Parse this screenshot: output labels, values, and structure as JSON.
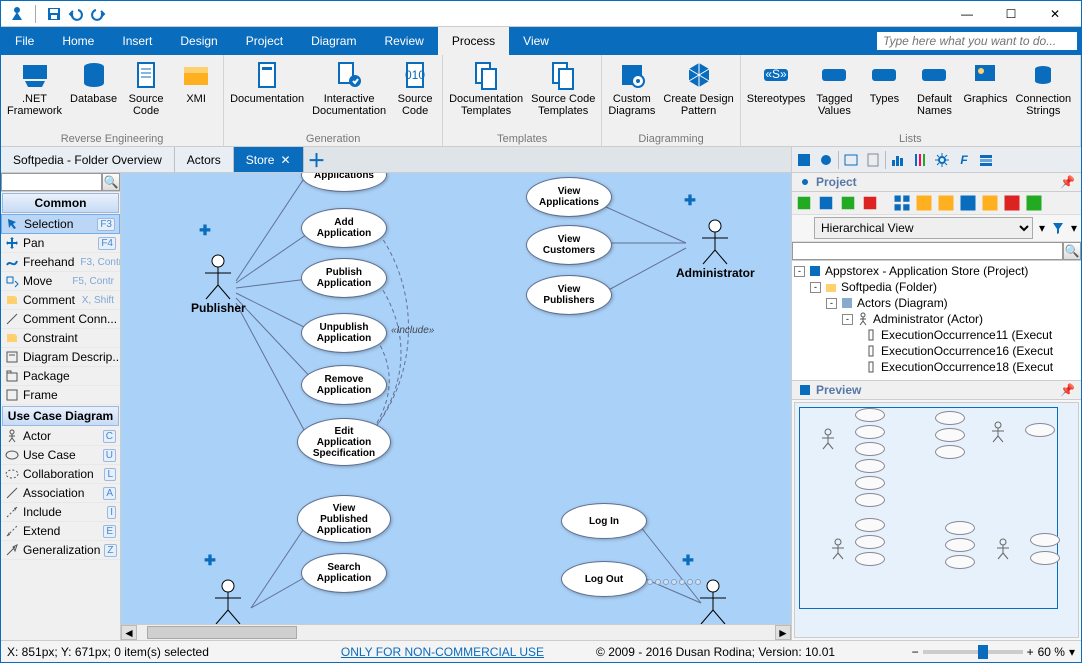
{
  "menubar": {
    "file": "File",
    "home": "Home",
    "insert": "Insert",
    "design": "Design",
    "project": "Project",
    "diagram": "Diagram",
    "review": "Review",
    "process": "Process",
    "view": "View",
    "search_placeholder": "Type here what you want to do..."
  },
  "ribbon": {
    "groups": {
      "reverse": {
        "label": "Reverse Engineering",
        "net": ".NET\nFramework",
        "database": "Database",
        "source": "Source\nCode",
        "xmi": "XMI"
      },
      "generation": {
        "label": "Generation",
        "doc": "Documentation",
        "interactive": "Interactive\nDocumentation",
        "source": "Source\nCode"
      },
      "templates": {
        "label": "Templates",
        "doc": "Documentation\nTemplates",
        "source": "Source Code\nTemplates"
      },
      "diagramming": {
        "label": "Diagramming",
        "custom": "Custom\nDiagrams",
        "pattern": "Create Design\nPattern"
      },
      "lists": {
        "label": "Lists",
        "stereo": "Stereotypes",
        "tagged": "Tagged\nValues",
        "types": "Types",
        "names": "Default\nNames",
        "graphics": "Graphics",
        "conn": "Connection\nStrings"
      }
    }
  },
  "docktabs": {
    "overview": "Softpedia - Folder Overview",
    "actors": "Actors",
    "store": "Store"
  },
  "toolbox": {
    "head_common": "Common",
    "selection": "Selection",
    "selection_key": "F3",
    "pan": "Pan",
    "pan_key": "F4",
    "freehand": "Freehand",
    "freehand_key": "F3, Contr",
    "move": "Move",
    "move_key": "F5, Contr",
    "comment": "Comment",
    "comment_key": "X, Shift",
    "comment_conn": "Comment Conn...",
    "constraint": "Constraint",
    "diag_desc": "Diagram Descrip...",
    "package": "Package",
    "frame": "Frame",
    "head_ucd": "Use Case Diagram",
    "actor": "Actor",
    "actor_key": "C",
    "usecase": "Use Case",
    "usecase_key": "U",
    "collab": "Collaboration",
    "collab_key": "L",
    "assoc": "Association",
    "assoc_key": "A",
    "include": "Include",
    "include_key": "I",
    "extend": "Extend",
    "extend_key": "E",
    "general": "Generalization",
    "general_key": "Z"
  },
  "canvas": {
    "uc_applications": "Applications",
    "uc_view_apps": "View\nApplications",
    "uc_add_app": "Add\nApplication",
    "uc_view_cust": "View\nCustomers",
    "uc_publish": "Publish\nApplication",
    "uc_view_pub": "View\nPublishers",
    "uc_unpublish": "Unpublish\nApplication",
    "uc_remove": "Remove\nApplication",
    "uc_edit_spec": "Edit\nApplication\nSpecification",
    "uc_vpa": "View\nPublished\nApplication",
    "uc_search": "Search\nApplication",
    "uc_login": "Log In",
    "uc_logout": "Log Out",
    "actor_publisher": "Publisher",
    "actor_admin": "Administrator",
    "include_label": "«Include»"
  },
  "project": {
    "title": "Project",
    "view_label": "Hierarchical View",
    "root": "Appstorex - Application Store (Project)",
    "folder": "Softpedia (Folder)",
    "diagram": "Actors (Diagram)",
    "admin": "Administrator (Actor)",
    "exec11": "ExecutionOccurrence11 (Execut",
    "exec16": "ExecutionOccurrence16 (Execut",
    "exec18": "ExecutionOccurrence18 (Execut"
  },
  "preview": {
    "title": "Preview"
  },
  "status": {
    "coords": "X: 851px; Y: 671px; 0 item(s) selected",
    "license": "ONLY FOR NON-COMMERCIAL USE",
    "copyright": "© 2009 - 2016 Dusan Rodina; Version: 10.01",
    "zoom": "60 %"
  }
}
